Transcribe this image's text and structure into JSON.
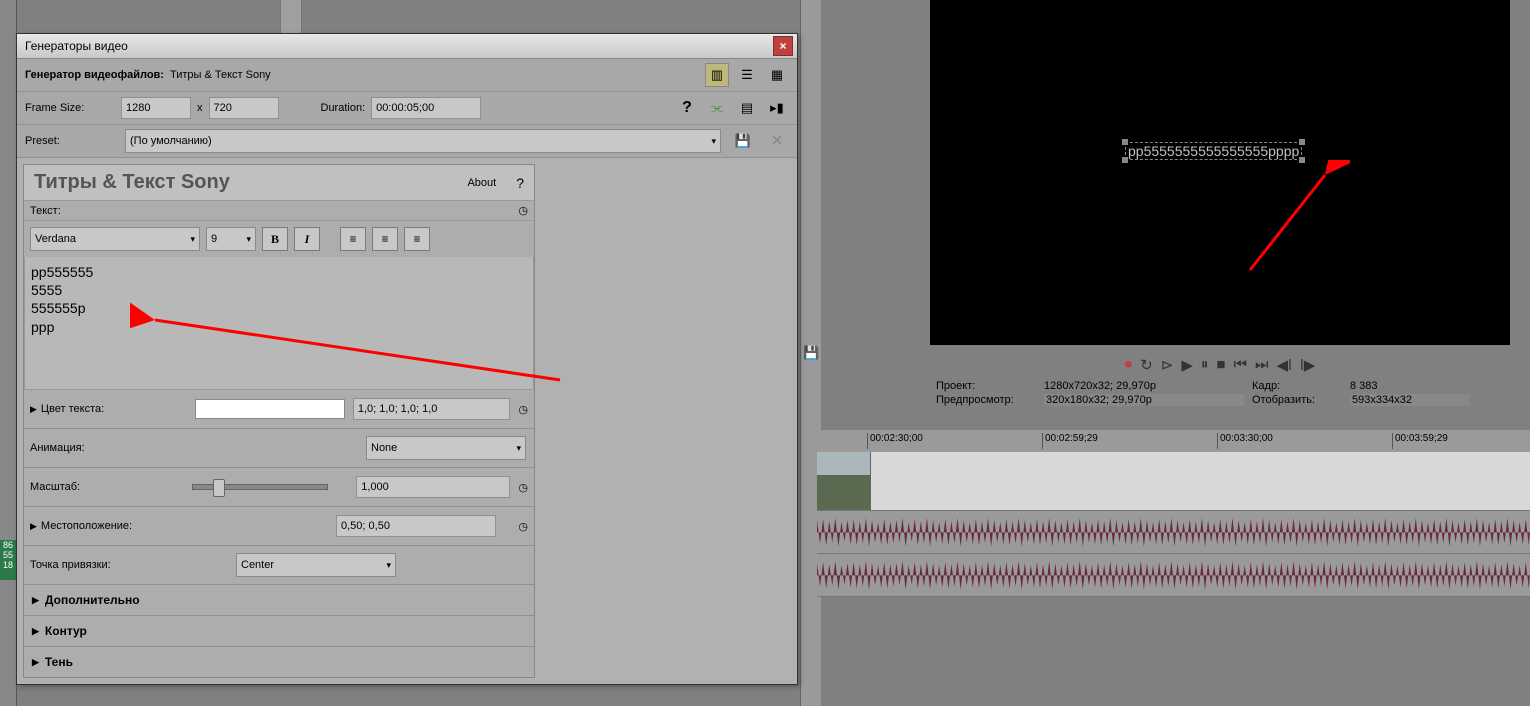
{
  "dialog": {
    "title": "Генераторы видео",
    "generator_label": "Генератор видеофайлов:",
    "generator_value": "Титры & Текст Sony",
    "frame_size_label": "Frame Size:",
    "width": "1280",
    "x": "x",
    "height": "720",
    "duration_label": "Duration:",
    "duration": "00:00:05;00",
    "preset_label": "Preset:",
    "preset": "(По умолчанию)"
  },
  "panel": {
    "title": "Титры & Текст Sony",
    "about": "About",
    "text_label": "Текст:",
    "font": "Verdana",
    "font_size": "9",
    "content": "pp555555\n5555\n555555p\nppp",
    "color_label": "Цвет текста:",
    "color_val": "1,0; 1,0; 1,0; 1,0",
    "anim_label": "Анимация:",
    "anim_val": "None",
    "scale_label": "Масштаб:",
    "scale_val": "1,000",
    "loc_label": "Местоположение:",
    "loc_val": "0,50; 0,50",
    "anchor_label": "Точка привязки:",
    "anchor_val": "Center",
    "extra": "Дополнительно",
    "outline": "Контур",
    "shadow": "Тень"
  },
  "preview": {
    "text": "pp5555555555555555pppp"
  },
  "info": {
    "project_l": "Проект:",
    "project_v": "1280x720x32; 29,970p",
    "frame_l": "Кадр:",
    "frame_v": "8 383",
    "prev_l": "Предпросмотр:",
    "prev_v": "320x180x32; 29,970p",
    "disp_l": "Отобразить:",
    "disp_v": "593x334x32"
  },
  "ruler": [
    "00:02:30;00",
    "00:02:59;29",
    "00:03:30;00",
    "00:03:59;29"
  ]
}
